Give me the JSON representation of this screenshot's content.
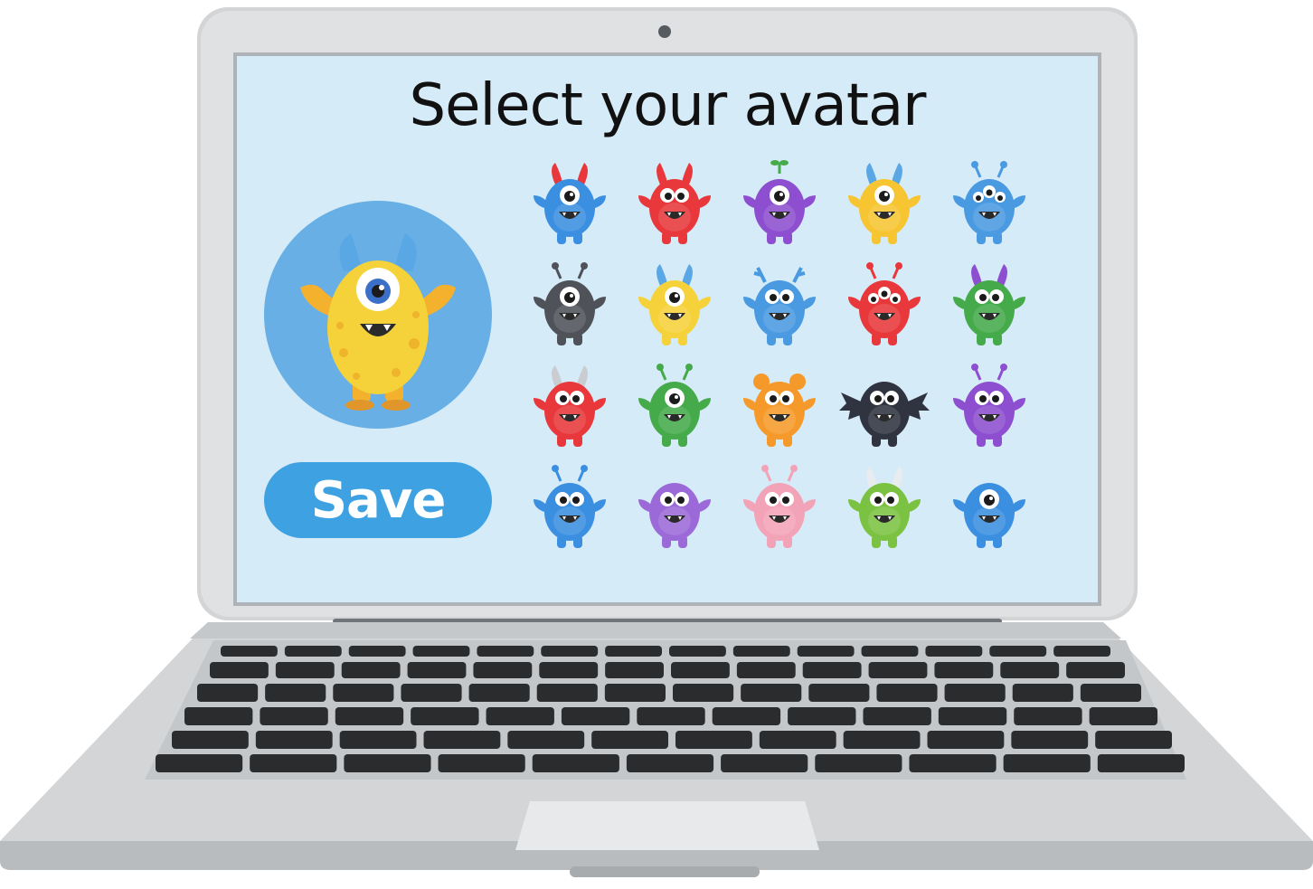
{
  "screen": {
    "title": "Select your avatar",
    "save_label": "Save",
    "selected_avatar": "yellow-cyclops-monster",
    "background_color": "#d6ebf8",
    "accent_color": "#3ea2e2"
  },
  "avatars": [
    {
      "id": "blue-horned-monster",
      "color": "#3b8fe0",
      "eyes": 1,
      "horns": "red"
    },
    {
      "id": "red-horned-monster",
      "color": "#e8383b",
      "eyes": 2,
      "horns": "red"
    },
    {
      "id": "purple-sprout-monster",
      "color": "#8d4fd0",
      "eyes": 1,
      "horns": "sprout"
    },
    {
      "id": "yellow-winged-monster",
      "color": "#f6c531",
      "eyes": 1,
      "horns": "blue"
    },
    {
      "id": "blue-tentacle-monster",
      "color": "#4a9ae2",
      "eyes": 3,
      "horns": "antenna"
    },
    {
      "id": "gray-shadow-monster",
      "color": "#4f5359",
      "eyes": 1,
      "horns": "antenna"
    },
    {
      "id": "yellow-cyclops-monster",
      "color": "#f6d23a",
      "eyes": 1,
      "horns": "blue"
    },
    {
      "id": "blue-furry-monster",
      "color": "#4a9ae2",
      "eyes": 2,
      "horns": "antler"
    },
    {
      "id": "red-antenna-monster",
      "color": "#e8383b",
      "eyes": 3,
      "horns": "antenna"
    },
    {
      "id": "green-horned-monster",
      "color": "#45ab4a",
      "eyes": 2,
      "horns": "purple"
    },
    {
      "id": "red-blob-monster",
      "color": "#e8383b",
      "eyes": 2,
      "horns": "gray"
    },
    {
      "id": "green-slug-monster",
      "color": "#45ab4a",
      "eyes": 1,
      "horns": "antenna"
    },
    {
      "id": "orange-bear-monster",
      "color": "#f59a2a",
      "eyes": 2,
      "horns": "ears"
    },
    {
      "id": "bat-wing-monster",
      "color": "#2f3440",
      "eyes": 2,
      "horns": "wings"
    },
    {
      "id": "purple-tongue-monster",
      "color": "#8d4fd0",
      "eyes": 2,
      "horns": "antenna"
    },
    {
      "id": "blue-slug-monster",
      "color": "#3b8fe0",
      "eyes": 2,
      "horns": "stalks"
    },
    {
      "id": "purple-goggle-monster",
      "color": "#9b6ad8",
      "eyes": 2,
      "horns": "none"
    },
    {
      "id": "pink-spotted-monster",
      "color": "#f3a3b8",
      "eyes": 2,
      "horns": "antenna"
    },
    {
      "id": "green-blob-monster",
      "color": "#7cc242",
      "eyes": 2,
      "horns": "white"
    },
    {
      "id": "blue-cyclops-monster",
      "color": "#3b8fe0",
      "eyes": 1,
      "horns": "none"
    }
  ],
  "icons": {
    "camera": "webcam-icon"
  }
}
